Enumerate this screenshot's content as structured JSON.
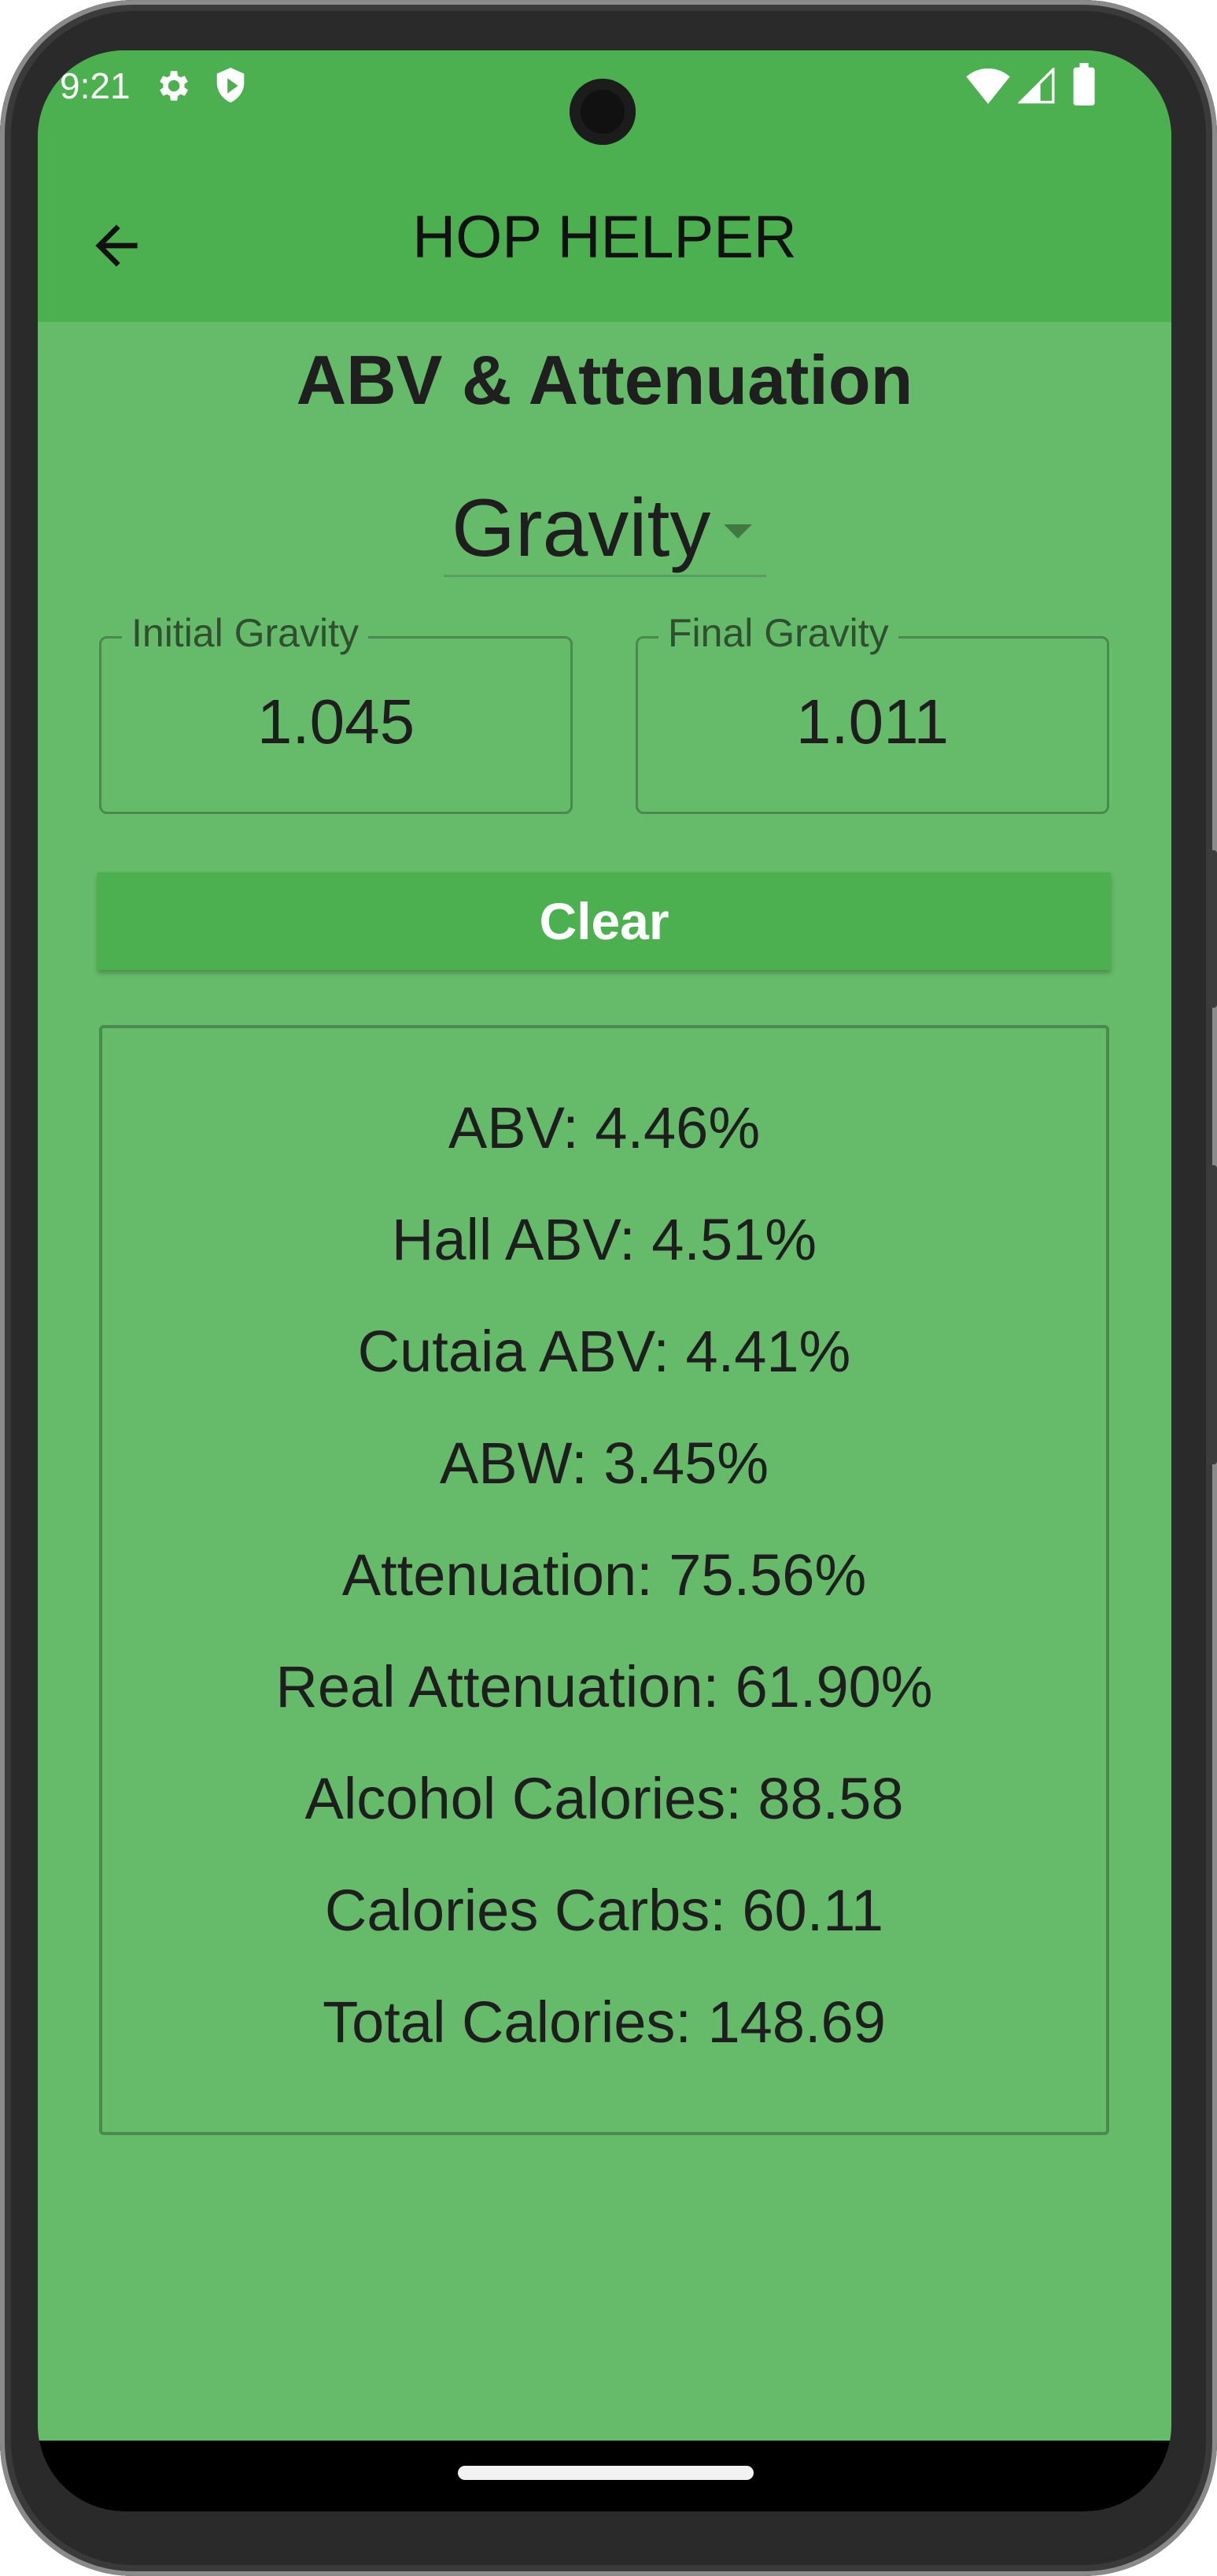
{
  "status_bar": {
    "time": "9:21"
  },
  "app_bar": {
    "title": "HOP HELPER"
  },
  "page": {
    "heading": "ABV & Attenuation"
  },
  "mode_dropdown": {
    "selected": "Gravity"
  },
  "inputs": {
    "initial_gravity": {
      "label": "Initial Gravity",
      "value": "1.045"
    },
    "final_gravity": {
      "label": "Final Gravity",
      "value": "1.011"
    }
  },
  "buttons": {
    "clear_label": "Clear"
  },
  "results": [
    "ABV: 4.46%",
    "Hall ABV: 4.51%",
    "Cutaia ABV: 4.41%",
    "ABW: 3.45%",
    "Attenuation: 75.56%",
    "Real Attenuation: 61.90%",
    "Alcohol Calories: 88.58",
    "Calories Carbs: 60.11",
    "Total Calories: 148.69"
  ],
  "colors": {
    "primary": "#4caf50",
    "background": "#66bb6a",
    "text": "#1e1e1e"
  },
  "icons": {
    "back": "arrow-left-icon",
    "settings": "gear-icon",
    "shield": "shield-icon",
    "wifi": "wifi-icon",
    "signal": "signal-icon",
    "battery": "battery-icon",
    "dropdown": "caret-down-icon"
  }
}
